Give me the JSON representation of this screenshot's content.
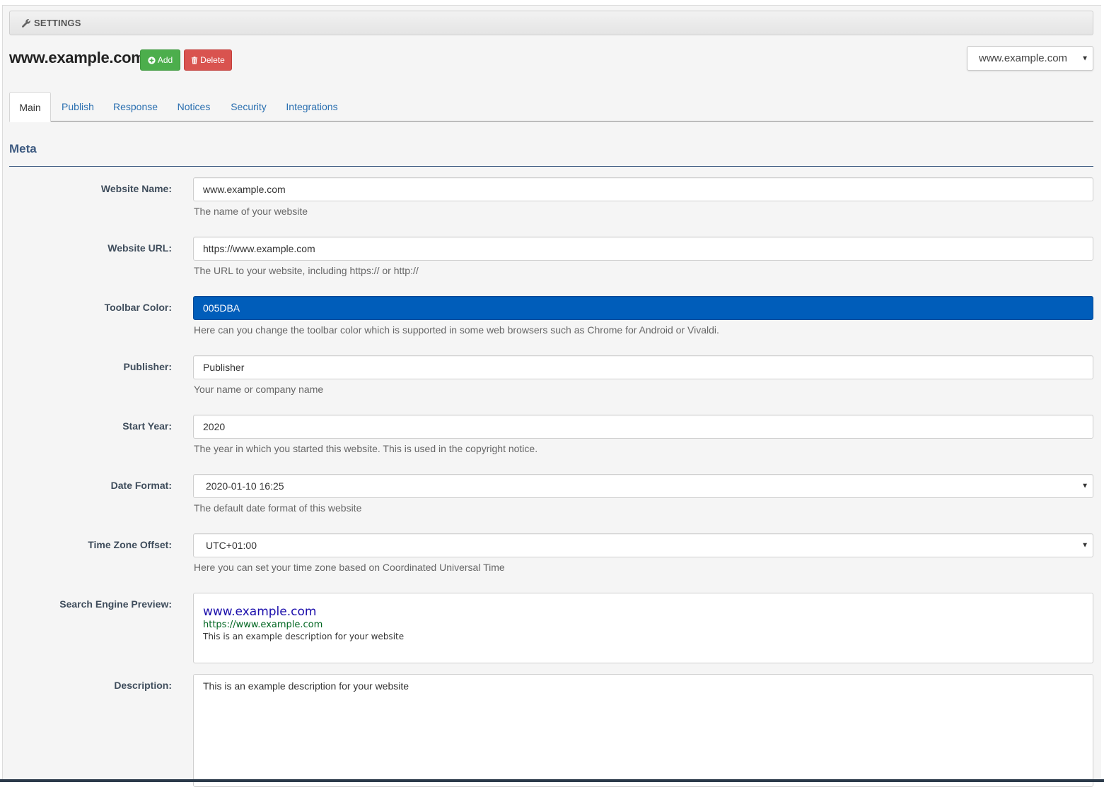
{
  "header": {
    "section_label": "SETTINGS",
    "site_title": "www.example.com",
    "add_label": "Add",
    "delete_label": "Delete",
    "site_select_value": "www.example.com"
  },
  "tabs": [
    {
      "label": "Main",
      "active": true
    },
    {
      "label": "Publish",
      "active": false
    },
    {
      "label": "Response",
      "active": false
    },
    {
      "label": "Notices",
      "active": false
    },
    {
      "label": "Security",
      "active": false
    },
    {
      "label": "Integrations",
      "active": false
    }
  ],
  "section": {
    "title": "Meta"
  },
  "form": {
    "website_name": {
      "label": "Website Name:",
      "value": "www.example.com",
      "help": "The name of your website"
    },
    "website_url": {
      "label": "Website URL:",
      "value": "https://www.example.com",
      "help": "The URL to your website, including https:// or http://"
    },
    "toolbar_color": {
      "label": "Toolbar Color:",
      "value": "005DBA",
      "help": "Here can you change the toolbar color which is supported in some web browsers such as Chrome for Android or Vivaldi."
    },
    "publisher": {
      "label": "Publisher:",
      "value": "Publisher",
      "help": "Your name or company name"
    },
    "start_year": {
      "label": "Start Year:",
      "value": "2020",
      "help": "The year in which you started this website. This is used in the copyright notice."
    },
    "date_format": {
      "label": "Date Format:",
      "value": "2020-01-10 16:25",
      "help": "The default date format of this website"
    },
    "time_zone": {
      "label": "Time Zone Offset:",
      "value": "UTC+01:00",
      "help": "Here you can set your time zone based on Coordinated Universal Time"
    },
    "preview": {
      "label": "Search Engine Preview:",
      "title": "www.example.com",
      "url": "https://www.example.com",
      "description": "This is an example description for your website"
    },
    "description": {
      "label": "Description:",
      "value": "This is an example description for your website"
    }
  },
  "colors": {
    "toolbar_color": "#005DBA",
    "add_button": "#4CAE4C",
    "delete_button": "#D9534F",
    "link": "#2A6FB0",
    "section_title": "#3D5A80"
  }
}
